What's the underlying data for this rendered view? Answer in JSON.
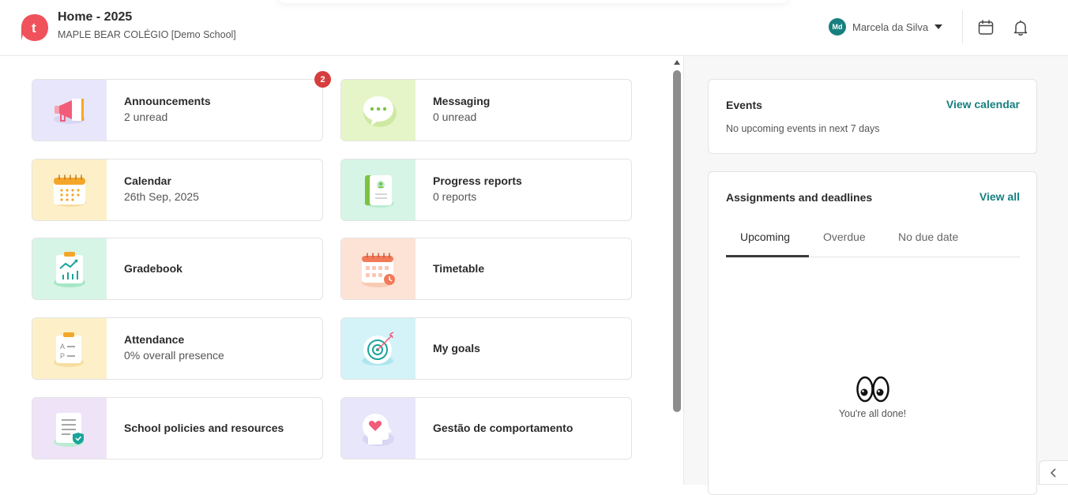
{
  "header": {
    "title": "Home - 2025",
    "school": "MAPLE BEAR COLÉGIO [Demo School]",
    "user": {
      "initials": "Md",
      "name": "Marcela da Silva"
    },
    "icons": [
      "calendar-icon",
      "bell-icon"
    ]
  },
  "tiles": [
    {
      "title": "Announcements",
      "subtitle": "2 unread",
      "badge": "2",
      "icon": "megaphone-icon",
      "color": "#e7e6fb"
    },
    {
      "title": "Messaging",
      "subtitle": "0 unread",
      "icon": "chat-bubble-icon",
      "color": "#e6f5c7"
    },
    {
      "title": "Calendar",
      "subtitle": "26th Sep, 2025",
      "icon": "calendar-icon",
      "color": "#fdf0c8"
    },
    {
      "title": "Progress reports",
      "subtitle": "0 reports",
      "icon": "report-book-icon",
      "color": "#d6f5e6"
    },
    {
      "title": "Gradebook",
      "icon": "chart-clipboard-icon",
      "color": "#d6f5e6"
    },
    {
      "title": "Timetable",
      "icon": "schedule-icon",
      "color": "#fde3d6"
    },
    {
      "title": "Attendance",
      "subtitle": "0% overall presence",
      "icon": "attendance-clipboard-icon",
      "color": "#fdf0c8"
    },
    {
      "title": "My goals",
      "icon": "target-icon",
      "color": "#d3f3f8"
    },
    {
      "title": "School policies and resources",
      "icon": "policy-document-icon",
      "color": "#efe3f8"
    },
    {
      "title": "Gestão de comportamento",
      "icon": "heart-head-icon",
      "color": "#e7e6fb"
    }
  ],
  "events": {
    "title": "Events",
    "link": "View calendar",
    "note": "No upcoming events in next 7 days"
  },
  "assignments": {
    "title": "Assignments and deadlines",
    "link": "View all",
    "tabs": [
      "Upcoming",
      "Overdue",
      "No due date"
    ],
    "active_tab": "Upcoming",
    "empty_text": "You're all done!"
  },
  "colors": {
    "accent": "#17807f",
    "badge": "#d63d3d",
    "logo": "#f0525b"
  }
}
